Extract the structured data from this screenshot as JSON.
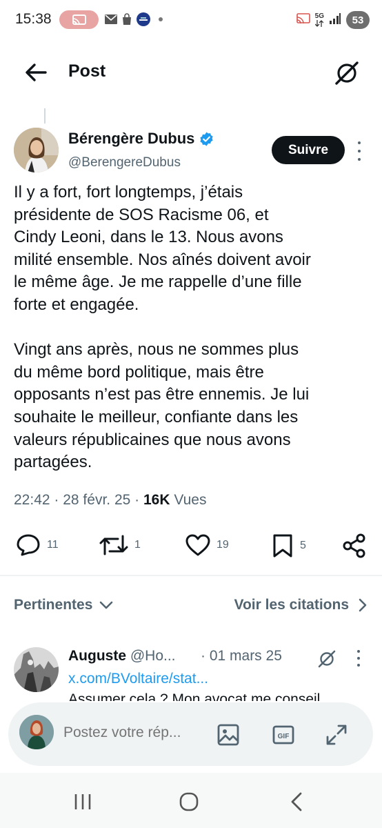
{
  "status_bar": {
    "time": "15:38",
    "battery": "53",
    "network": "5G"
  },
  "header": {
    "title": "Post"
  },
  "post": {
    "author_name": "Bérengère Dubus",
    "author_handle": "@BerengereDubus",
    "follow_label": "Suivre",
    "text_lines": [
      "Il y  a fort, fort longtemps, j’étais",
      "présidente de SOS Racisme 06, et",
      "Cindy Leoni, dans le 13. Nous avons",
      "milité ensemble. Nos aînés doivent avoir",
      "le même âge. Je me rappelle d’une fille",
      "forte et engagée.",
      "",
      "Vingt ans après, nous ne sommes plus",
      "du même bord politique, mais être",
      "opposants n’est pas être ennemis. Je lui",
      "souhaite le meilleur, confiante dans les",
      "valeurs républicaines que nous avons",
      "partagées."
    ],
    "time": "22:42",
    "date": "28 févr. 25",
    "views_count": "16K",
    "views_label": "Vues",
    "replies": "11",
    "reposts": "1",
    "likes": "19",
    "bookmarks": "5"
  },
  "replies_bar": {
    "sort_label": "Pertinentes",
    "quotes_label": "Voir les citations"
  },
  "reply": {
    "name": "Auguste",
    "handle": "@Ho...",
    "date": "· 01 mars 25",
    "link": "x.com/BVoltaire/stat...",
    "text": "Assumer cela ? Mon avocat me conseil"
  },
  "composer": {
    "placeholder": "Postez votre rép..."
  },
  "colors": {
    "text": "#0f1419",
    "secondary": "#536471",
    "link": "#1d9bf0",
    "verified": "#1d9bf0"
  },
  "icons": {
    "back": "arrow-left-icon",
    "grok": "grok-icon",
    "reply": "speech-bubble-icon",
    "repost": "repost-arrows-icon",
    "like": "heart-icon",
    "bookmark": "bookmark-icon",
    "share": "share-icon",
    "image": "image-icon",
    "gif": "gif-icon",
    "expand": "expand-icon"
  }
}
